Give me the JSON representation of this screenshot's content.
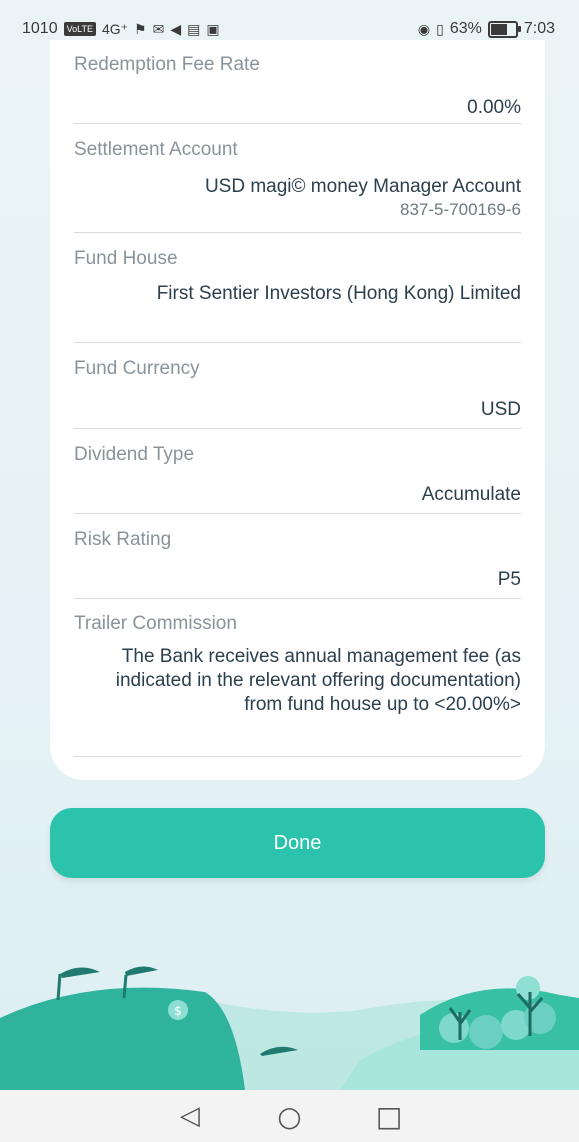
{
  "status_bar": {
    "left_text": "1010",
    "badge_volte": "VoLTE",
    "signal_label": "4G⁺",
    "battery_percent": "63%",
    "time": "7:03"
  },
  "details": [
    {
      "label": "Redemption Fee Rate",
      "value": "0.00%",
      "sub": ""
    },
    {
      "label": "Settlement Account",
      "value": "USD magi© money Manager Account",
      "sub": "837-5-700169-6"
    },
    {
      "label": "Fund House",
      "value": "First Sentier Investors (Hong Kong) Limited",
      "sub": ""
    },
    {
      "label": "Fund Currency",
      "value": "USD",
      "sub": ""
    },
    {
      "label": "Dividend Type",
      "value": "Accumulate",
      "sub": ""
    },
    {
      "label": "Risk Rating",
      "value": "P5",
      "sub": ""
    },
    {
      "label": "Trailer Commission",
      "value": "The Bank receives annual management fee (as indicated in the relevant offering documentation) from fund house up to <20.00%>",
      "sub": ""
    }
  ],
  "done_label": "Done",
  "illustration": {
    "coin_symbol": "$"
  },
  "nav": {
    "back": "◁",
    "home": "○",
    "recents": "□"
  }
}
